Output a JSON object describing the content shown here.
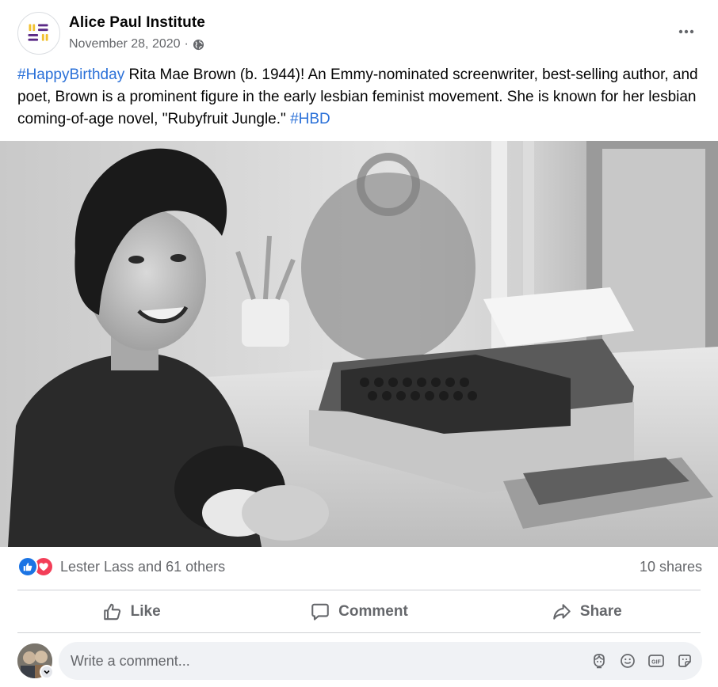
{
  "post": {
    "page_name": "Alice Paul Institute",
    "date": "November 28, 2020",
    "separator": "·",
    "privacy_icon": "globe-icon",
    "more_icon": "more-horizontal-icon",
    "text_segments": [
      {
        "text": "#HappyBirthday",
        "hashtag": true
      },
      {
        "text": " Rita Mae Brown (b. 1944)! An Emmy-nominated screenwriter, best-selling author, and poet, Brown is a prominent figure in the early lesbian feminist movement. She is known for her lesbian coming-of-age novel, \"Rubyfruit Jungle.\" ",
        "hashtag": false
      },
      {
        "text": "#HBD",
        "hashtag": true
      }
    ]
  },
  "logo_colors": {
    "purple": "#5b2a86",
    "yellow": "#f2c12e"
  },
  "reactions": {
    "icons": [
      "like-icon",
      "love-icon"
    ],
    "summary": "Lester Lass and 61 others",
    "shares": "10 shares"
  },
  "actions": [
    {
      "label": "Like",
      "icon": "thumbs-up-icon"
    },
    {
      "label": "Comment",
      "icon": "comment-icon"
    },
    {
      "label": "Share",
      "icon": "share-icon"
    }
  ],
  "comment": {
    "placeholder": "Write a comment...",
    "tools": [
      "avatar-sticker-icon",
      "emoji-icon",
      "gif-icon",
      "sticker-icon"
    ]
  },
  "colors": {
    "hashtag": "#2a70d8",
    "secondary_text": "#65676b",
    "like_blue": "#1b74e4",
    "love_red": "#f33e58"
  }
}
